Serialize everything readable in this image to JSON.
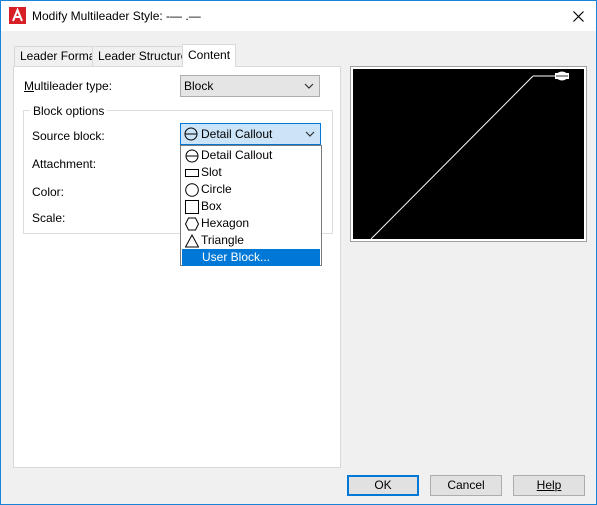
{
  "window": {
    "title": "Modify Multileader Style: -—  .—",
    "close_glyph": "✕"
  },
  "tabs": [
    {
      "label": "Leader Format"
    },
    {
      "label": "Leader Structure"
    },
    {
      "label": "Content"
    }
  ],
  "content": {
    "multileader_type_label": "Multileader type:",
    "multileader_type_value": "Block",
    "block_options_label": "Block options",
    "source_block_label": "Source block:",
    "source_block_value": "Detail Callout",
    "attachment_label": "Attachment:",
    "color_label": "Color:",
    "scale_label": "Scale:"
  },
  "source_block_options": [
    {
      "label": "Detail Callout",
      "icon": "detail-callout-icon",
      "selected": false
    },
    {
      "label": "Slot",
      "icon": "slot-icon",
      "selected": false
    },
    {
      "label": "Circle",
      "icon": "circle-icon",
      "selected": false
    },
    {
      "label": "Box",
      "icon": "box-icon",
      "selected": false
    },
    {
      "label": "Hexagon",
      "icon": "hexagon-icon",
      "selected": false
    },
    {
      "label": "Triangle",
      "icon": "triangle-icon",
      "selected": false
    },
    {
      "label": "User Block...",
      "icon": "",
      "selected": true
    }
  ],
  "buttons": {
    "ok": "OK",
    "cancel": "Cancel",
    "help": "Help"
  },
  "colors": {
    "accent": "#0078d7",
    "preview_background": "#000000",
    "preview_line": "#ffffff"
  }
}
